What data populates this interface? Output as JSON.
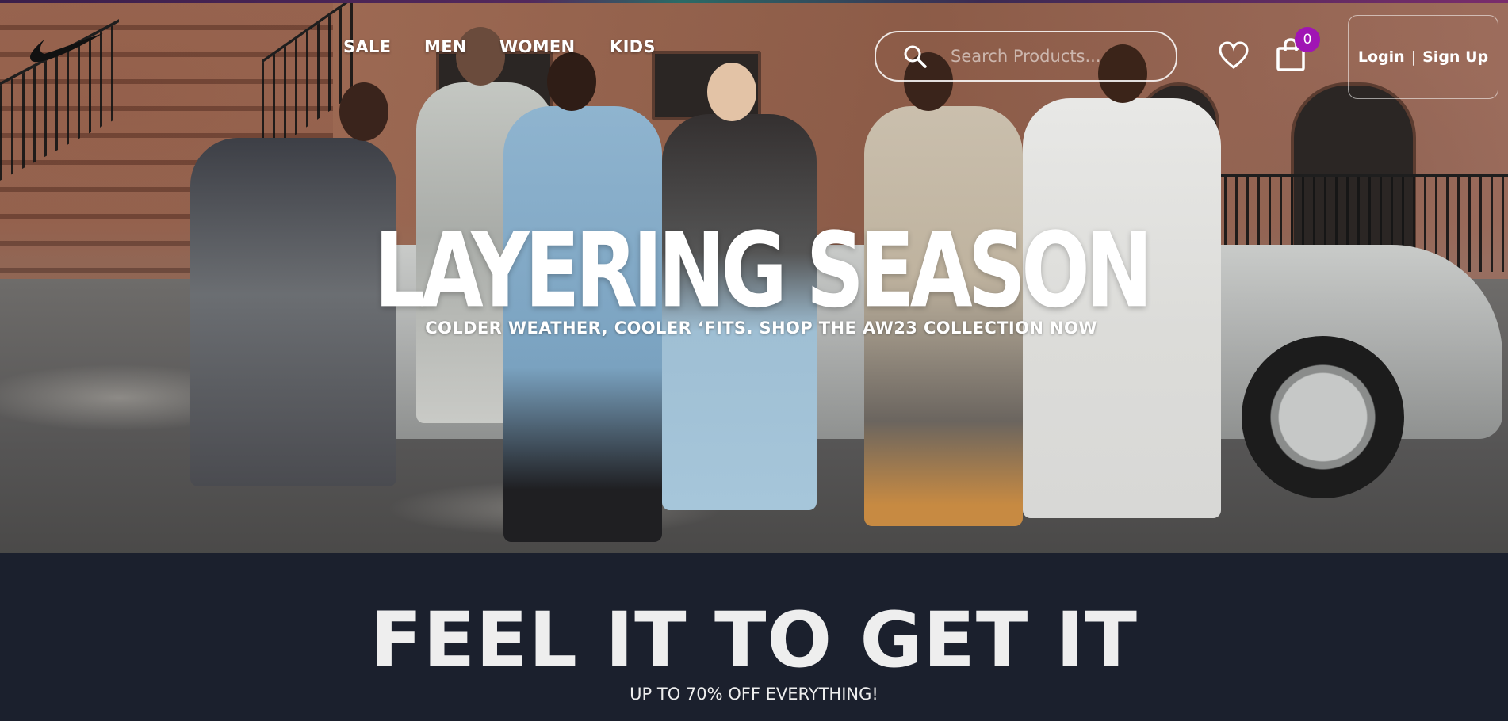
{
  "nav": {
    "links": [
      "SALE",
      "MEN",
      "WOMEN",
      "KIDS"
    ]
  },
  "search": {
    "placeholder": "Search Products..."
  },
  "cart": {
    "count": "0"
  },
  "auth": {
    "login": "Login",
    "separator": "|",
    "signup": "Sign Up"
  },
  "hero": {
    "title": "LAYERING SEASON",
    "subtitle": "COLDER WEATHER, COOLER ‘FITS. SHOP THE AW23 COLLECTION NOW"
  },
  "promo": {
    "title": "FEEL IT TO GET IT",
    "subtitle": "UP TO 70% OFF EVERYTHING!"
  },
  "icons": {
    "logo": "nike-swoosh-logo",
    "search": "search-icon",
    "wishlist": "heart-icon",
    "cart": "shopping-bag-icon"
  },
  "colors": {
    "badge": "#a015b4",
    "footer_band": "#1b202d"
  }
}
